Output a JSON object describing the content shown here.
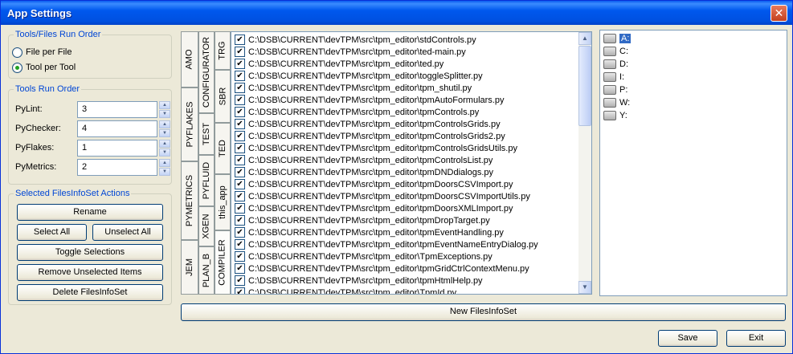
{
  "window": {
    "title": "App Settings",
    "close_glyph": "✕"
  },
  "run_order": {
    "legend": "Tools/Files Run Order",
    "options": [
      {
        "label": "File per File",
        "checked": false
      },
      {
        "label": "Tool per Tool",
        "checked": true
      }
    ]
  },
  "tools_order": {
    "legend": "Tools Run Order",
    "rows": [
      {
        "label": "PyLint:",
        "value": "3"
      },
      {
        "label": "PyChecker:",
        "value": "4"
      },
      {
        "label": "PyFlakes:",
        "value": "1"
      },
      {
        "label": "PyMetrics:",
        "value": "2"
      }
    ]
  },
  "actions": {
    "legend": "Selected FilesInfoSet Actions",
    "rename": "Rename",
    "select_all": "Select All",
    "unselect_all": "Unselect All",
    "toggle": "Toggle Selections",
    "remove": "Remove Unselected Items",
    "delete": "Delete FilesInfoSet"
  },
  "tabs": {
    "col1": [
      "AMO",
      "PYFLAKES",
      "PYMETRICS",
      "JEM"
    ],
    "col2": [
      "CONFIGURATOR",
      "TEST",
      "PYFLUID",
      "XGEN",
      "PLAN_B"
    ],
    "col3": [
      "TRG",
      "SBR",
      "TED",
      "this_app",
      "COMPILER"
    ]
  },
  "files": [
    "C:\\DSB\\CURRENT\\devTPM\\src\\tpm_editor\\stdControls.py",
    "C:\\DSB\\CURRENT\\devTPM\\src\\tpm_editor\\ted-main.py",
    "C:\\DSB\\CURRENT\\devTPM\\src\\tpm_editor\\ted.py",
    "C:\\DSB\\CURRENT\\devTPM\\src\\tpm_editor\\toggleSplitter.py",
    "C:\\DSB\\CURRENT\\devTPM\\src\\tpm_editor\\tpm_shutil.py",
    "C:\\DSB\\CURRENT\\devTPM\\src\\tpm_editor\\tpmAutoFormulars.py",
    "C:\\DSB\\CURRENT\\devTPM\\src\\tpm_editor\\tpmControls.py",
    "C:\\DSB\\CURRENT\\devTPM\\src\\tpm_editor\\tpmControlsGrids.py",
    "C:\\DSB\\CURRENT\\devTPM\\src\\tpm_editor\\tpmControlsGrids2.py",
    "C:\\DSB\\CURRENT\\devTPM\\src\\tpm_editor\\tpmControlsGridsUtils.py",
    "C:\\DSB\\CURRENT\\devTPM\\src\\tpm_editor\\tpmControlsList.py",
    "C:\\DSB\\CURRENT\\devTPM\\src\\tpm_editor\\tpmDNDdialogs.py",
    "C:\\DSB\\CURRENT\\devTPM\\src\\tpm_editor\\tpmDoorsCSVImport.py",
    "C:\\DSB\\CURRENT\\devTPM\\src\\tpm_editor\\tpmDoorsCSVImportUtils.py",
    "C:\\DSB\\CURRENT\\devTPM\\src\\tpm_editor\\tpmDoorsXMLImport.py",
    "C:\\DSB\\CURRENT\\devTPM\\src\\tpm_editor\\tpmDropTarget.py",
    "C:\\DSB\\CURRENT\\devTPM\\src\\tpm_editor\\tpmEventHandling.py",
    "C:\\DSB\\CURRENT\\devTPM\\src\\tpm_editor\\tpmEventNameEntryDialog.py",
    "C:\\DSB\\CURRENT\\devTPM\\src\\tpm_editor\\TpmExceptions.py",
    "C:\\DSB\\CURRENT\\devTPM\\src\\tpm_editor\\tpmGridCtrlContextMenu.py",
    "C:\\DSB\\CURRENT\\devTPM\\src\\tpm_editor\\tpmHtmlHelp.py",
    "C:\\DSB\\CURRENT\\devTPM\\src\\tpm_editor\\TpmId.py"
  ],
  "drives": [
    "A:",
    "C:",
    "D:",
    "I:",
    "P:",
    "W:",
    "Y:"
  ],
  "new_set": "New FilesInfoSet",
  "save": "Save",
  "exit": "Exit"
}
